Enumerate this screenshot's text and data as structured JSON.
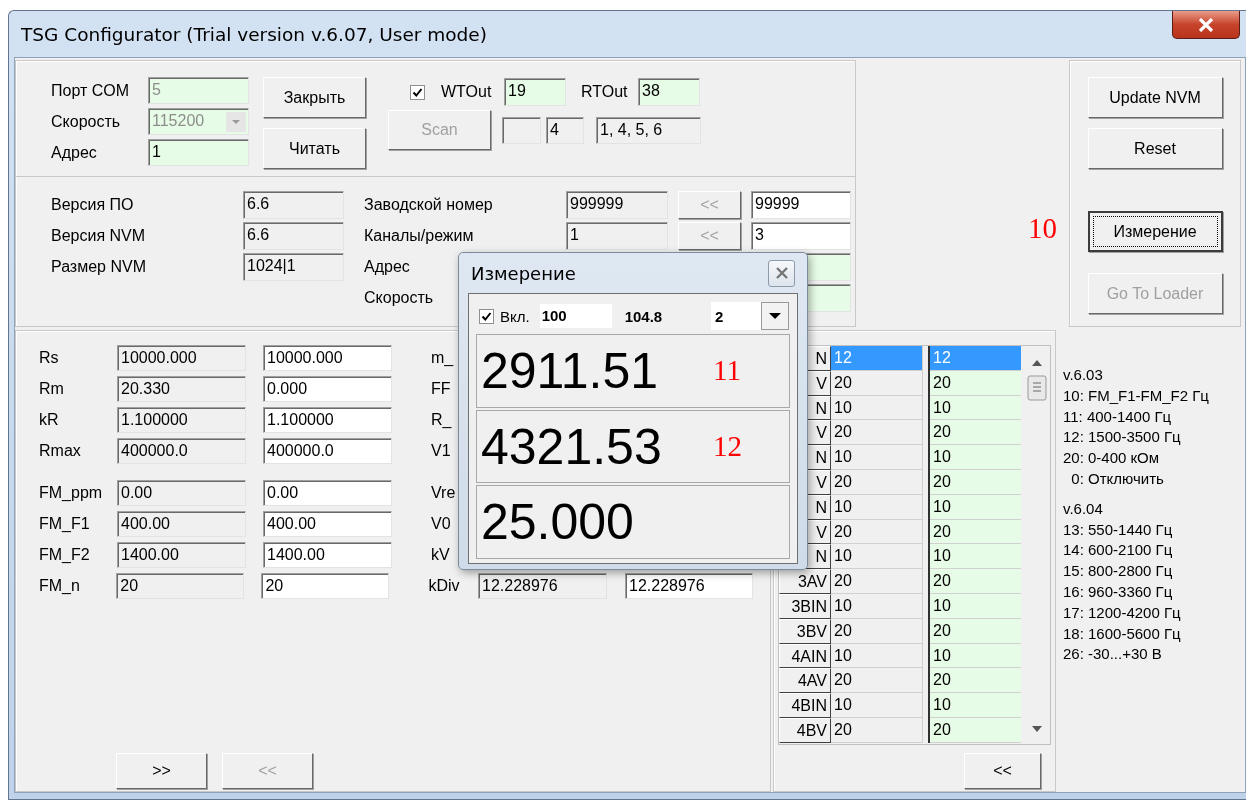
{
  "window": {
    "title": "TSG Configurator (Trial version v.6.07, User mode)"
  },
  "connection": {
    "fields": [
      {
        "label": "Порт COM",
        "value": "5",
        "disabled": true,
        "kind": "text"
      },
      {
        "label": "Скорость",
        "value": "115200",
        "disabled": true,
        "kind": "dropdown"
      },
      {
        "label": "Адрес",
        "value": "1",
        "disabled": false,
        "kind": "text"
      }
    ],
    "buttons": [
      "Закрыть",
      "Читать"
    ],
    "wtout": {
      "checked": true,
      "label": "WTOut",
      "value": "19"
    },
    "rtout": {
      "label": "RTOut",
      "value": "38"
    },
    "scan_button": {
      "label": "Scan",
      "disabled": true
    },
    "scan_count": "4",
    "scan_result": "1, 4, 5, 6"
  },
  "info": {
    "left": [
      {
        "label": "Версия ПО",
        "value": "6.6"
      },
      {
        "label": "Версия NVM",
        "value": "6.6"
      },
      {
        "label": "Размер NVM",
        "value": "1024|1"
      }
    ],
    "right": [
      {
        "label": "Заводской номер",
        "value": "999999",
        "button": "<<",
        "new_value": "99999",
        "kind": "plain"
      },
      {
        "label": "Каналы/режим",
        "value": "1",
        "button": "<<",
        "new_value": "3",
        "kind": "plain"
      },
      {
        "label": "Адрес",
        "kind": "green"
      },
      {
        "label": "Скорость",
        "kind": "green"
      }
    ]
  },
  "side_buttons": [
    {
      "label": "Update NVM",
      "disabled": false,
      "focused": false
    },
    {
      "label": "Reset",
      "disabled": false,
      "focused": false
    },
    {
      "label": "Измерение",
      "disabled": false,
      "focused": true
    },
    {
      "label": "Go To Loader",
      "disabled": true,
      "focused": false
    }
  ],
  "annotation": "10",
  "params": {
    "groups": [
      [
        {
          "label": "Rs",
          "device": "10000.000",
          "new": "10000.000",
          "label2": "m_"
        },
        {
          "label": "Rm",
          "device": "20.330",
          "new": "0.000",
          "label2": "FF"
        },
        {
          "label": "kR",
          "device": "1.100000",
          "new": "1.100000",
          "label2": "R_"
        },
        {
          "label": "Rmax",
          "device": "400000.0",
          "new": "400000.0",
          "label2": "V1"
        }
      ],
      [
        {
          "label": "FM_ppm",
          "device": "0.00",
          "new": "0.00",
          "label2": "Vre"
        },
        {
          "label": "FM_F1",
          "device": "400.00",
          "new": "400.00",
          "label2": "V0"
        },
        {
          "label": "FM_F2",
          "device": "1400.00",
          "new": "1400.00",
          "label2": "kV"
        },
        {
          "label": "FM_n",
          "device": "20",
          "new": "20",
          "label2": "kDiv",
          "device2": "12.228976",
          "new2": "12.228976"
        }
      ]
    ],
    "buttons": [
      {
        "label": ">>",
        "disabled": false
      },
      {
        "label": "<<",
        "disabled": true
      }
    ]
  },
  "table": {
    "rows": [
      {
        "label": "N",
        "value": "12",
        "new_value": "12",
        "selected": true
      },
      {
        "label": "V",
        "value": "20",
        "new_value": "20",
        "selected": false
      },
      {
        "label": "N",
        "value": "10",
        "new_value": "10",
        "selected": false
      },
      {
        "label": "V",
        "value": "20",
        "new_value": "20",
        "selected": false
      },
      {
        "label": "N",
        "value": "10",
        "new_value": "10",
        "selected": false
      },
      {
        "label": "V",
        "value": "20",
        "new_value": "20",
        "selected": false
      },
      {
        "label": "N",
        "value": "10",
        "new_value": "10",
        "selected": false
      },
      {
        "label": "V",
        "value": "20",
        "new_value": "20",
        "selected": false
      },
      {
        "label": "N",
        "value": "10",
        "new_value": "10",
        "selected": false
      },
      {
        "label": "3AV",
        "value": "20",
        "new_value": "20",
        "selected": false
      },
      {
        "label": "3BIN",
        "value": "10",
        "new_value": "10",
        "selected": false
      },
      {
        "label": "3BV",
        "value": "20",
        "new_value": "20",
        "selected": false
      },
      {
        "label": "4AIN",
        "value": "10",
        "new_value": "10",
        "selected": false
      },
      {
        "label": "4AV",
        "value": "20",
        "new_value": "20",
        "selected": false
      },
      {
        "label": "4BIN",
        "value": "10",
        "new_value": "10",
        "selected": false
      },
      {
        "label": "4BV",
        "value": "20",
        "new_value": "20",
        "selected": false
      }
    ],
    "button": "<<"
  },
  "notes": [
    [
      "v.6.03",
      "10: FM_F1-FM_F2 Гц",
      "11: 400-1400 Гц",
      "12: 1500-3500 Гц",
      "20: 0-400 кОм",
      "  0: Отключить"
    ],
    [
      "v.6.04",
      "13: 550-1440 Гц",
      "14: 600-2100 Гц",
      "15: 800-2800 Гц",
      "16: 960-3360 Гц",
      "17: 1200-4200 Гц",
      "18: 1600-5600 Гц",
      "26: -30...+30 В"
    ]
  ],
  "dialog": {
    "title": "Измерение",
    "enabled": {
      "checked": true,
      "label": "Вкл."
    },
    "setpoint": "100",
    "reading": "104.8",
    "mode": "2",
    "values": [
      {
        "value": "2911.51",
        "note": "11"
      },
      {
        "value": "4321.53",
        "note": "12"
      },
      {
        "value": "25.000"
      }
    ]
  }
}
